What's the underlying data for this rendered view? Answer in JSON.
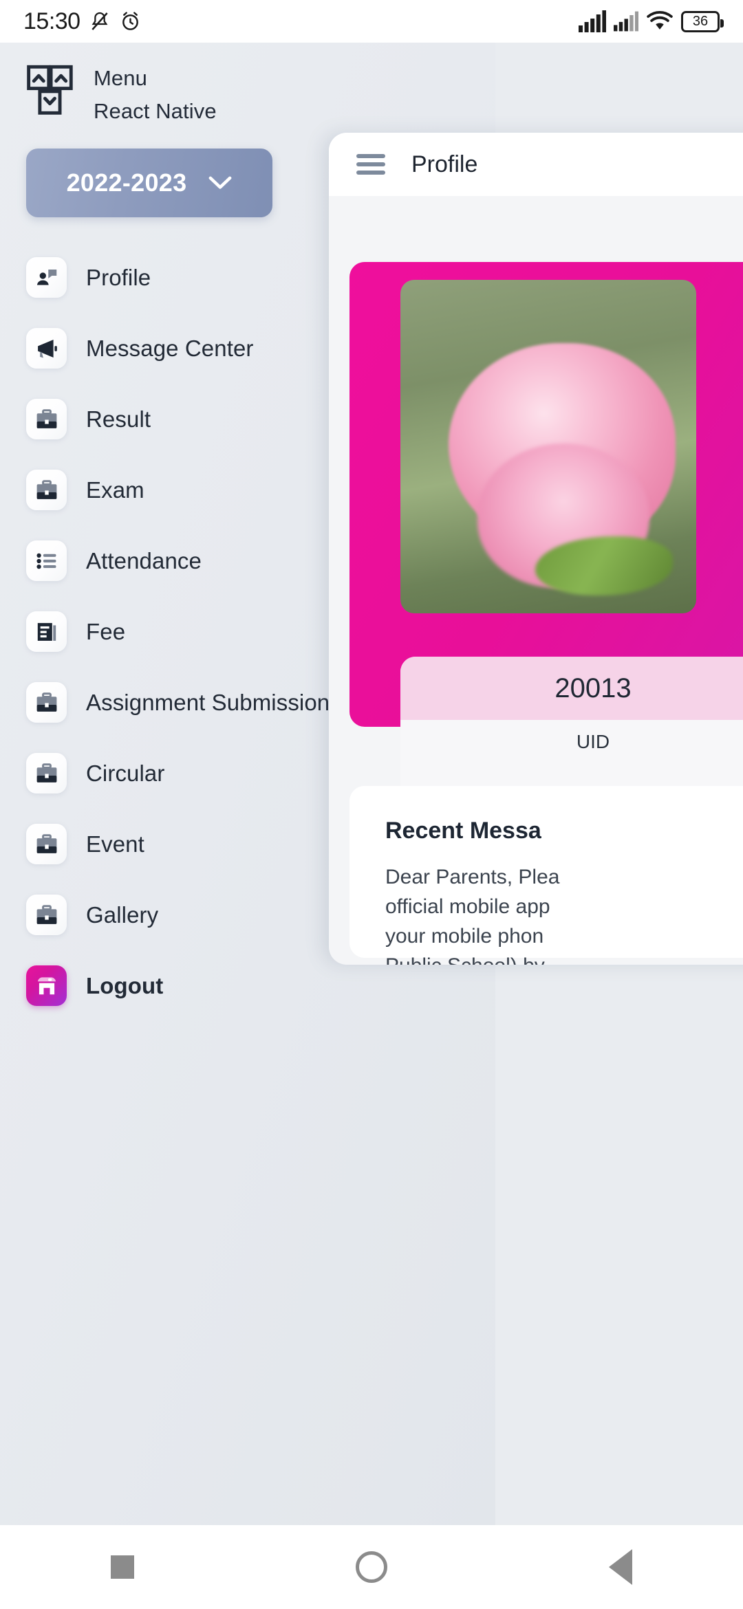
{
  "status_bar": {
    "time": "15:30",
    "icons": [
      "mute-icon",
      "alarm-icon",
      "signal-icon",
      "signal-icon",
      "wifi-icon"
    ],
    "battery_level": "36"
  },
  "drawer": {
    "brand": {
      "line1": "Menu",
      "line2": "React Native",
      "logo_icon": "menu-arrows-logo-icon"
    },
    "year_selector": {
      "value": "2022-2023",
      "chevron_icon": "chevron-down-icon"
    },
    "items": [
      {
        "label": "Profile",
        "icon": "person-message-icon"
      },
      {
        "label": "Message Center",
        "icon": "megaphone-icon"
      },
      {
        "label": "Result",
        "icon": "briefcase-icon"
      },
      {
        "label": "Exam",
        "icon": "briefcase-icon"
      },
      {
        "label": "Attendance",
        "icon": "list-bullet-icon"
      },
      {
        "label": "Fee",
        "icon": "article-icon"
      },
      {
        "label": "Assignment Submission",
        "icon": "briefcase-icon"
      },
      {
        "label": "Circular",
        "icon": "briefcase-icon"
      },
      {
        "label": "Event",
        "icon": "briefcase-icon"
      },
      {
        "label": "Gallery",
        "icon": "briefcase-icon"
      },
      {
        "label": "Logout",
        "icon": "storefront-icon"
      }
    ]
  },
  "content": {
    "header": {
      "title": "Profile",
      "menu_icon": "hamburger-icon"
    },
    "profile": {
      "photo_alt": "pink-rose-photo",
      "uid_value": "20013",
      "uid_label": "UID"
    },
    "recent_message": {
      "title": "Recent Messa",
      "lines": [
        "Dear Parents, Plea",
        "official mobile app",
        "your mobile phon",
        "Public School) by"
      ]
    }
  },
  "nav_bar": {
    "buttons": [
      "recents-square-icon",
      "home-circle-icon",
      "back-triangle-icon"
    ]
  },
  "colors": {
    "drawer_bg": "#e7eaef",
    "year_btn": "#8e9cbe",
    "profile_card": "#ef0f9c",
    "logout_gradient_start": "#e8139b",
    "logout_gradient_end": "#a32fd4",
    "uid_head": "#f6d3e8",
    "text_dark": "#222a36"
  }
}
